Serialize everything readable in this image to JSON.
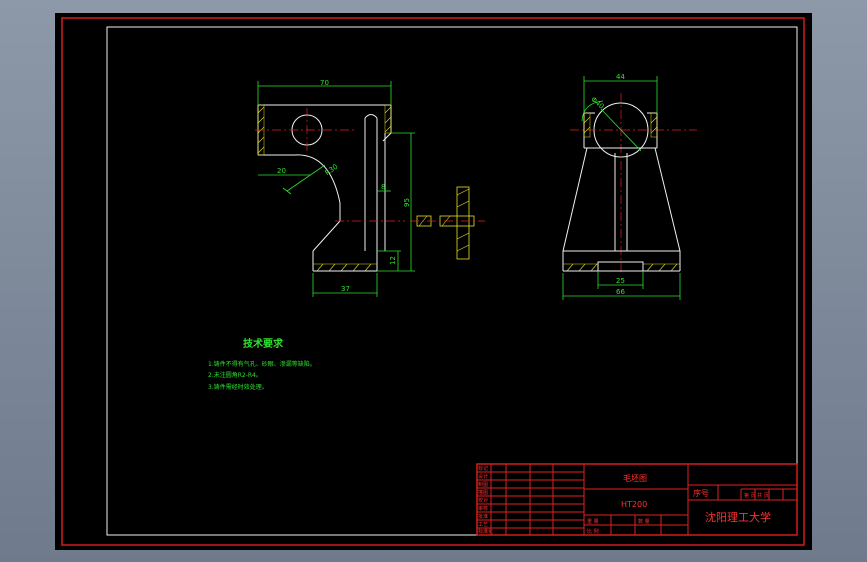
{
  "dimensions": {
    "width_70": "70",
    "width_20": "20",
    "radius_r30": "R30",
    "height_8": "8",
    "height_95": "95",
    "height_12": "12",
    "width_37": "37",
    "width_44": "44",
    "dia_40": "Φ40",
    "width_25": "25",
    "width_66": "66"
  },
  "tech_requirements": {
    "title": "技术要求",
    "items": [
      "1.铸件不得有气孔、砂眼、渗漏等缺陷。",
      "2.未注圆角R2-R4。",
      "3.铸件需经时效处理。"
    ]
  },
  "title_block": {
    "drawing_name": "毛坯图",
    "material": "HT200",
    "serial_label": "序号",
    "school": "沈阳理工大学",
    "sheet_label": "第 页 共 页",
    "ratio_label": "比 例",
    "qty_label": "数 量",
    "weight_label": "重 量",
    "left_labels": [
      "标记",
      "设计",
      "制图",
      "描图",
      "校对",
      "审核",
      "批准",
      "工艺",
      "标准化"
    ]
  },
  "colors": {
    "frame": "#e02020",
    "dimension": "#2ee02e",
    "hatch": "#e8e020",
    "outline": "#f0f0f0"
  }
}
